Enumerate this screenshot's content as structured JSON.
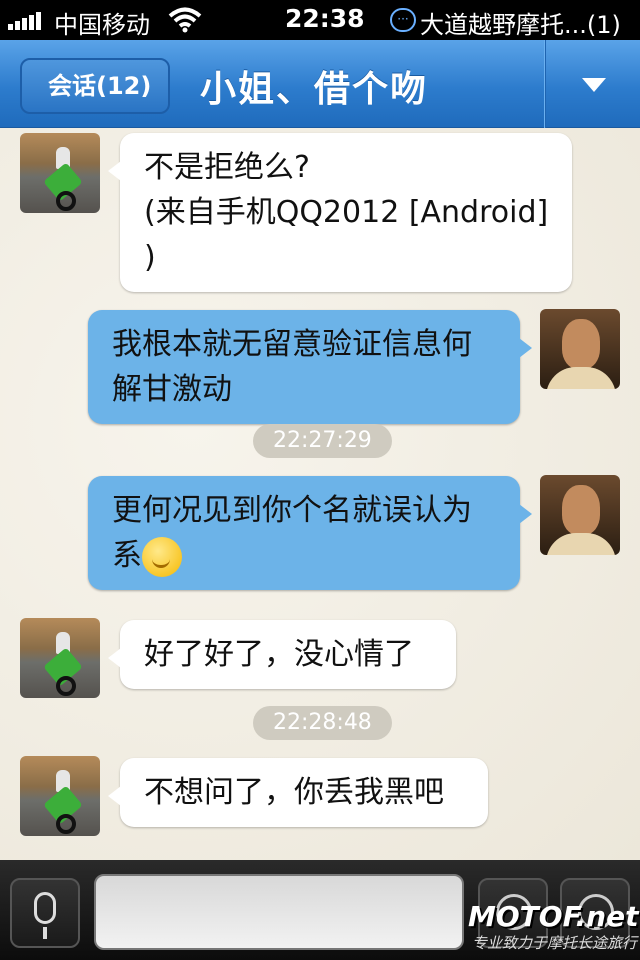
{
  "status_bar": {
    "carrier": "中国移动",
    "time": "22:38",
    "notification": "大道越野摩托...(1)"
  },
  "nav": {
    "back_label": "会话(12)",
    "title": "小姐、借个吻"
  },
  "messages": [
    {
      "side": "in",
      "lines": [
        "不是拒绝么?",
        "(来自手机QQ2012 [Android]",
        ")"
      ]
    },
    {
      "side": "out",
      "lines": [
        "我根本就无留意验证信息何",
        "解甘激动"
      ]
    },
    {
      "timestamp": "22:27:29"
    },
    {
      "side": "out",
      "lines": [
        "更何况见到你个名就误认为",
        "系"
      ],
      "emoji": "sweat-smile-emoji"
    },
    {
      "side": "in",
      "lines": [
        "好了好了，没心情了"
      ]
    },
    {
      "timestamp": "22:28:48"
    },
    {
      "side": "in",
      "lines": [
        "不想问了，你丢我黑吧"
      ]
    }
  ],
  "toolbar": {
    "watermark": "MOTOF.net",
    "watermark_sub": "专业致力于摩托长途旅行"
  },
  "icons": {
    "signal": "signal-bars-icon",
    "wifi": "wifi-icon",
    "message": "qq-message-icon",
    "dropdown": "chevron-down-icon",
    "voice": "microphone-icon",
    "emoji": "emoji-icon",
    "more": "plus-icon"
  },
  "colors": {
    "nav_blue": "#2d7ccd",
    "outgoing_bubble": "#6cb3e8",
    "incoming_bubble": "#ffffff"
  }
}
